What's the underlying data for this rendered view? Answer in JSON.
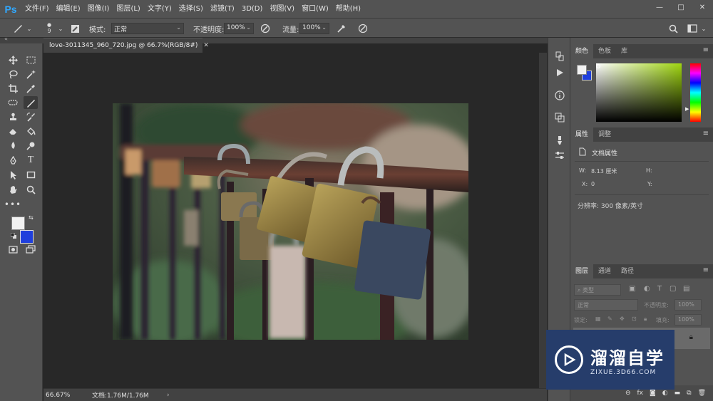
{
  "app": {
    "logo": "Ps"
  },
  "menu": [
    "文件(F)",
    "编辑(E)",
    "图像(I)",
    "图层(L)",
    "文字(Y)",
    "选择(S)",
    "滤镜(T)",
    "3D(D)",
    "视图(V)",
    "窗口(W)",
    "帮助(H)"
  ],
  "window_controls": {
    "minimize": "—",
    "restore": "□",
    "close": "✕"
  },
  "options": {
    "brush_size": "9",
    "mode_label": "模式:",
    "mode_value": "正常",
    "opacity_label": "不透明度:",
    "opacity_value": "100%",
    "flow_label": "流量:",
    "flow_value": "100%"
  },
  "document": {
    "tab_title": "love-3011345_960_720.jpg @ 66.7%(RGB/8#)",
    "close": "✕"
  },
  "status": {
    "zoom": "66.67%",
    "doc_info": "文档:1.76M/1.76M",
    "arrow": "›"
  },
  "color_panel": {
    "tabs": [
      "颜色",
      "色板",
      "库"
    ]
  },
  "properties_panel": {
    "tabs": [
      "属性",
      "调整"
    ],
    "section": "文档属性",
    "w_label": "W:",
    "w_value": "8.13 厘米",
    "h_label": "H:",
    "x_label": "X:",
    "x_value": "0",
    "y_label": "Y:",
    "resolution": "分辨率: 300 像素/英寸"
  },
  "layers_panel": {
    "tabs": [
      "图层",
      "通道",
      "路径"
    ],
    "filter_placeholder": "类型",
    "blend_mode": "正常",
    "opacity_label": "不透明度:",
    "opacity_value": "100%",
    "lock_label": "锁定:",
    "fill_label": "填充:",
    "fill_value": "100%"
  },
  "watermark": {
    "title": "溜溜自学",
    "url": "ZIXUE.3D66.COM"
  },
  "colors": {
    "foreground": "#f2f2f2",
    "background": "#1f3fdc",
    "accent": "#31a8ff"
  }
}
